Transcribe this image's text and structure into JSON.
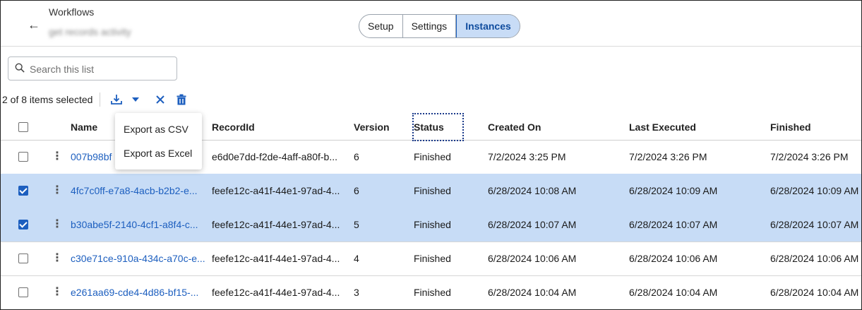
{
  "header": {
    "breadcrumb": "Workflows",
    "subtitle": "get records activity",
    "tabs": [
      {
        "label": "Setup",
        "active": false
      },
      {
        "label": "Settings",
        "active": false
      },
      {
        "label": "Instances",
        "active": true
      }
    ]
  },
  "search": {
    "placeholder": "Search this list",
    "value": ""
  },
  "selection": {
    "text": "2 of 8 items selected"
  },
  "export_menu": {
    "items": [
      "Export as CSV",
      "Export as Excel"
    ]
  },
  "columns": [
    "Name",
    "RecordId",
    "Version",
    "Status",
    "Created On",
    "Last Executed",
    "Finished"
  ],
  "rows": [
    {
      "selected": false,
      "name": "007b98bf",
      "record": "e6d0e7dd-f2de-4aff-a80f-b...",
      "version": "6",
      "status": "Finished",
      "created": "7/2/2024 3:25 PM",
      "executed": "7/2/2024 3:26 PM",
      "finished": "7/2/2024 3:26 PM"
    },
    {
      "selected": true,
      "name": "4fc7c0ff-e7a8-4acb-b2b2-e...",
      "record": "feefe12c-a41f-44e1-97ad-4...",
      "version": "6",
      "status": "Finished",
      "created": "6/28/2024 10:08 AM",
      "executed": "6/28/2024 10:09 AM",
      "finished": "6/28/2024 10:09 AM"
    },
    {
      "selected": true,
      "name": "b30abe5f-2140-4cf1-a8f4-c...",
      "record": "feefe12c-a41f-44e1-97ad-4...",
      "version": "5",
      "status": "Finished",
      "created": "6/28/2024 10:07 AM",
      "executed": "6/28/2024 10:07 AM",
      "finished": "6/28/2024 10:07 AM"
    },
    {
      "selected": false,
      "name": "c30e71ce-910a-434c-a70c-e...",
      "record": "feefe12c-a41f-44e1-97ad-4...",
      "version": "4",
      "status": "Finished",
      "created": "6/28/2024 10:06 AM",
      "executed": "6/28/2024 10:06 AM",
      "finished": "6/28/2024 10:06 AM"
    },
    {
      "selected": false,
      "name": "e261aa69-cde4-4d86-bf15-...",
      "record": "feefe12c-a41f-44e1-97ad-4...",
      "version": "3",
      "status": "Finished",
      "created": "6/28/2024 10:04 AM",
      "executed": "6/28/2024 10:04 AM",
      "finished": "6/28/2024 10:04 AM"
    }
  ],
  "icons": [
    "back-arrow-icon",
    "search-icon",
    "download-icon",
    "caret-down-icon",
    "close-icon",
    "trash-icon",
    "kebab-icon"
  ],
  "colors": {
    "accent": "#1d5fbf",
    "selected_row": "#c7dcf6",
    "active_tab": "#c8dcf6"
  }
}
